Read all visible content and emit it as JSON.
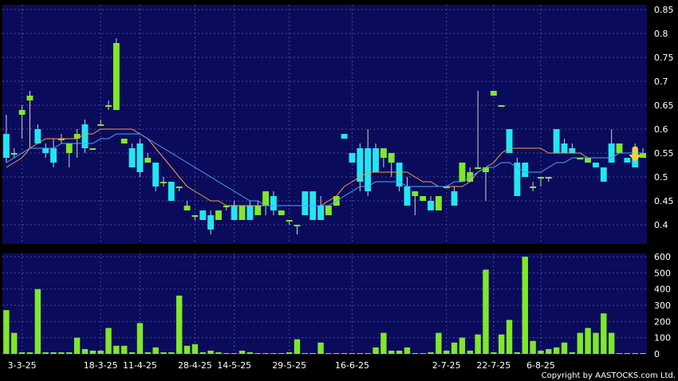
{
  "copyright": "Copyright by AASTOCKS.com Ltd.",
  "colors": {
    "background": "#000000",
    "panel": "#0b0b5c",
    "grid": "#4a4a9a",
    "up": "#7fe82a",
    "down": "#22e6f0",
    "ma_short": "#4aa8ff",
    "ma_long": "#f0a040",
    "signal_arrow": "#f5d033"
  },
  "chart_data": [
    {
      "type": "candlestick",
      "ylim": [
        0.36,
        0.86
      ],
      "yticks": [
        "0.85",
        "0.8",
        "0.75",
        "0.7",
        "0.65",
        "0.6",
        "0.55",
        "0.5",
        "0.45",
        "0.4"
      ],
      "yticks_values": [
        0.85,
        0.8,
        0.75,
        0.7,
        0.65,
        0.6,
        0.55,
        0.5,
        0.45,
        0.4
      ],
      "xticks": [
        "3-3-25",
        "18-3-25",
        "11-4-25",
        "28-4-25",
        "14-5-25",
        "29-5-25",
        "16-6-25",
        "2-7-25",
        "22-7-25",
        "6-8-25"
      ],
      "xticks_index": [
        2,
        12,
        17,
        24,
        29,
        36,
        44,
        56,
        62,
        68
      ],
      "ohlc": [
        [
          0.59,
          0.63,
          0.53,
          0.54
        ],
        [
          0.55,
          0.56,
          0.54,
          0.55
        ],
        [
          0.63,
          0.65,
          0.58,
          0.64
        ],
        [
          0.66,
          0.68,
          0.56,
          0.67
        ],
        [
          0.6,
          0.61,
          0.57,
          0.57
        ],
        [
          0.56,
          0.57,
          0.54,
          0.55
        ],
        [
          0.56,
          0.58,
          0.52,
          0.53
        ],
        [
          0.58,
          0.59,
          0.57,
          0.58
        ],
        [
          0.55,
          0.57,
          0.52,
          0.57
        ],
        [
          0.58,
          0.6,
          0.54,
          0.59
        ],
        [
          0.61,
          0.62,
          0.55,
          0.56
        ],
        [
          0.56,
          0.56,
          0.56,
          0.56
        ],
        [
          0.61,
          0.62,
          0.61,
          0.61
        ],
        [
          0.65,
          0.66,
          0.64,
          0.65
        ],
        [
          0.64,
          0.79,
          0.64,
          0.78
        ],
        [
          0.57,
          0.58,
          0.57,
          0.58
        ],
        [
          0.56,
          0.57,
          0.52,
          0.52
        ],
        [
          0.57,
          0.58,
          0.5,
          0.51
        ],
        [
          0.53,
          0.55,
          0.53,
          0.54
        ],
        [
          0.53,
          0.53,
          0.47,
          0.48
        ],
        [
          0.49,
          0.5,
          0.48,
          0.49
        ],
        [
          0.49,
          0.49,
          0.45,
          0.45
        ],
        [
          0.48,
          0.48,
          0.47,
          0.48
        ],
        [
          0.43,
          0.45,
          0.43,
          0.44
        ],
        [
          0.42,
          0.42,
          0.41,
          0.42
        ],
        [
          0.43,
          0.43,
          0.41,
          0.41
        ],
        [
          0.42,
          0.43,
          0.38,
          0.39
        ],
        [
          0.41,
          0.43,
          0.41,
          0.43
        ],
        [
          0.44,
          0.44,
          0.43,
          0.44
        ],
        [
          0.44,
          0.45,
          0.41,
          0.41
        ],
        [
          0.41,
          0.44,
          0.41,
          0.44
        ],
        [
          0.44,
          0.45,
          0.41,
          0.41
        ],
        [
          0.42,
          0.45,
          0.42,
          0.44
        ],
        [
          0.44,
          0.47,
          0.42,
          0.47
        ],
        [
          0.46,
          0.47,
          0.42,
          0.43
        ],
        [
          0.42,
          0.43,
          0.42,
          0.43
        ],
        [
          0.41,
          0.41,
          0.4,
          0.41
        ],
        [
          0.4,
          0.4,
          0.38,
          0.4
        ],
        [
          0.47,
          0.47,
          0.42,
          0.42
        ],
        [
          0.47,
          0.47,
          0.41,
          0.41
        ],
        [
          0.44,
          0.46,
          0.41,
          0.41
        ],
        [
          0.42,
          0.44,
          0.42,
          0.44
        ],
        [
          0.44,
          0.46,
          0.44,
          0.46
        ],
        [
          0.59,
          0.59,
          0.58,
          0.58
        ],
        [
          0.55,
          0.55,
          0.53,
          0.53
        ],
        [
          0.56,
          0.57,
          0.47,
          0.49
        ],
        [
          0.56,
          0.6,
          0.46,
          0.47
        ],
        [
          0.56,
          0.57,
          0.51,
          0.51
        ],
        [
          0.54,
          0.56,
          0.52,
          0.56
        ],
        [
          0.53,
          0.55,
          0.5,
          0.55
        ],
        [
          0.53,
          0.53,
          0.47,
          0.48
        ],
        [
          0.48,
          0.5,
          0.44,
          0.44
        ],
        [
          0.46,
          0.47,
          0.42,
          0.47
        ],
        [
          0.45,
          0.46,
          0.45,
          0.46
        ],
        [
          0.45,
          0.46,
          0.43,
          0.43
        ],
        [
          0.43,
          0.46,
          0.43,
          0.46
        ],
        [
          0.48,
          0.48,
          0.48,
          0.48
        ],
        [
          0.47,
          0.48,
          0.44,
          0.44
        ],
        [
          0.49,
          0.53,
          0.49,
          0.53
        ],
        [
          0.49,
          0.52,
          0.49,
          0.51
        ],
        [
          0.52,
          0.68,
          0.52,
          0.52
        ],
        [
          0.51,
          0.52,
          0.45,
          0.52
        ],
        [
          0.67,
          0.68,
          0.67,
          0.68
        ],
        [
          0.65,
          0.65,
          0.65,
          0.65
        ],
        [
          0.6,
          0.6,
          0.55,
          0.55
        ],
        [
          0.53,
          0.54,
          0.46,
          0.46
        ],
        [
          0.53,
          0.53,
          0.5,
          0.5
        ],
        [
          0.48,
          0.49,
          0.47,
          0.48
        ],
        [
          0.5,
          0.5,
          0.48,
          0.5
        ],
        [
          0.5,
          0.5,
          0.49,
          0.5
        ],
        [
          0.6,
          0.6,
          0.55,
          0.55
        ],
        [
          0.57,
          0.58,
          0.55,
          0.55
        ],
        [
          0.56,
          0.57,
          0.55,
          0.55
        ],
        [
          0.54,
          0.54,
          0.54,
          0.54
        ],
        [
          0.53,
          0.54,
          0.53,
          0.54
        ],
        [
          0.53,
          0.53,
          0.52,
          0.52
        ],
        [
          0.52,
          0.52,
          0.49,
          0.49
        ],
        [
          0.57,
          0.6,
          0.53,
          0.53
        ],
        [
          0.55,
          0.57,
          0.55,
          0.57
        ],
        [
          0.54,
          0.54,
          0.53,
          0.53
        ],
        [
          0.56,
          0.57,
          0.52,
          0.52
        ],
        [
          0.54,
          0.56,
          0.54,
          0.55
        ]
      ],
      "ma_short": [
        0.53,
        0.54,
        0.55,
        0.56,
        0.56,
        0.56,
        0.56,
        0.57,
        0.57,
        0.57,
        0.57,
        0.57,
        0.58,
        0.58,
        0.59,
        0.59,
        0.59,
        0.59,
        0.58,
        0.57,
        0.56,
        0.55,
        0.54,
        0.53,
        0.52,
        0.51,
        0.5,
        0.49,
        0.48,
        0.47,
        0.46,
        0.45,
        0.45,
        0.44,
        0.44,
        0.44,
        0.44,
        0.44,
        0.44,
        0.44,
        0.44,
        0.44,
        0.45,
        0.46,
        0.47,
        0.48,
        0.48,
        0.49,
        0.49,
        0.49,
        0.49,
        0.48,
        0.48,
        0.48,
        0.48,
        0.48,
        0.48,
        0.49,
        0.49,
        0.5,
        0.51,
        0.52,
        0.52,
        0.53,
        0.53,
        0.52,
        0.51,
        0.51,
        0.51,
        0.52,
        0.53,
        0.53,
        0.54,
        0.54,
        0.54,
        0.54,
        0.54,
        0.54,
        0.55,
        0.55,
        0.55,
        0.55
      ],
      "ma_long": [
        0.52,
        0.53,
        0.54,
        0.56,
        0.57,
        0.58,
        0.58,
        0.58,
        0.58,
        0.58,
        0.59,
        0.59,
        0.6,
        0.6,
        0.6,
        0.6,
        0.6,
        0.59,
        0.58,
        0.56,
        0.54,
        0.52,
        0.5,
        0.48,
        0.47,
        0.46,
        0.45,
        0.45,
        0.44,
        0.44,
        0.44,
        0.44,
        0.44,
        0.44,
        0.44,
        0.44,
        0.44,
        0.44,
        0.44,
        0.44,
        0.44,
        0.45,
        0.46,
        0.48,
        0.49,
        0.5,
        0.51,
        0.51,
        0.51,
        0.51,
        0.51,
        0.51,
        0.5,
        0.49,
        0.49,
        0.48,
        0.48,
        0.48,
        0.48,
        0.49,
        0.51,
        0.52,
        0.53,
        0.55,
        0.56,
        0.56,
        0.56,
        0.56,
        0.56,
        0.55,
        0.55,
        0.55,
        0.55,
        0.55,
        0.54,
        0.54,
        0.54,
        0.54,
        0.55,
        0.55,
        0.55,
        0.55
      ],
      "signal_arrow_index": 80
    },
    {
      "type": "bar",
      "ylim": [
        0,
        620
      ],
      "yticks": [
        "600",
        "500",
        "400",
        "300",
        "200",
        "100",
        "0"
      ],
      "yticks_values": [
        600,
        500,
        400,
        300,
        200,
        100,
        0
      ],
      "values": [
        270,
        130,
        10,
        10,
        400,
        10,
        10,
        10,
        10,
        100,
        30,
        20,
        20,
        160,
        50,
        50,
        10,
        190,
        10,
        40,
        10,
        10,
        360,
        50,
        60,
        10,
        20,
        10,
        5,
        5,
        20,
        10,
        5,
        5,
        5,
        5,
        10,
        90,
        5,
        5,
        70,
        5,
        5,
        5,
        5,
        5,
        5,
        40,
        130,
        20,
        20,
        40,
        5,
        5,
        10,
        130,
        20,
        70,
        100,
        20,
        120,
        520,
        10,
        120,
        210,
        10,
        600,
        80,
        20,
        30,
        40,
        70,
        10,
        130,
        160,
        130,
        250,
        130,
        5,
        5,
        5,
        5
      ],
      "colors": [
        "up",
        "up",
        "up",
        "up",
        "up",
        "up",
        "up",
        "up",
        "up",
        "up",
        "up",
        "up",
        "up",
        "up",
        "up",
        "up",
        "up",
        "up",
        "up",
        "up",
        "up",
        "up",
        "up",
        "up",
        "up",
        "up",
        "up",
        "up",
        "up",
        "up",
        "up",
        "up",
        "up",
        "up",
        "up",
        "up",
        "up",
        "up",
        "up",
        "up",
        "up",
        "up",
        "up",
        "up",
        "up",
        "up",
        "up",
        "up",
        "up",
        "up",
        "up",
        "up",
        "up",
        "up",
        "up",
        "up",
        "up",
        "up",
        "up",
        "up",
        "up",
        "up",
        "up",
        "up",
        "up",
        "up",
        "up",
        "up",
        "up",
        "up",
        "up",
        "up",
        "up",
        "up",
        "up",
        "up",
        "up",
        "up",
        "up",
        "up",
        "up",
        "up"
      ]
    }
  ]
}
